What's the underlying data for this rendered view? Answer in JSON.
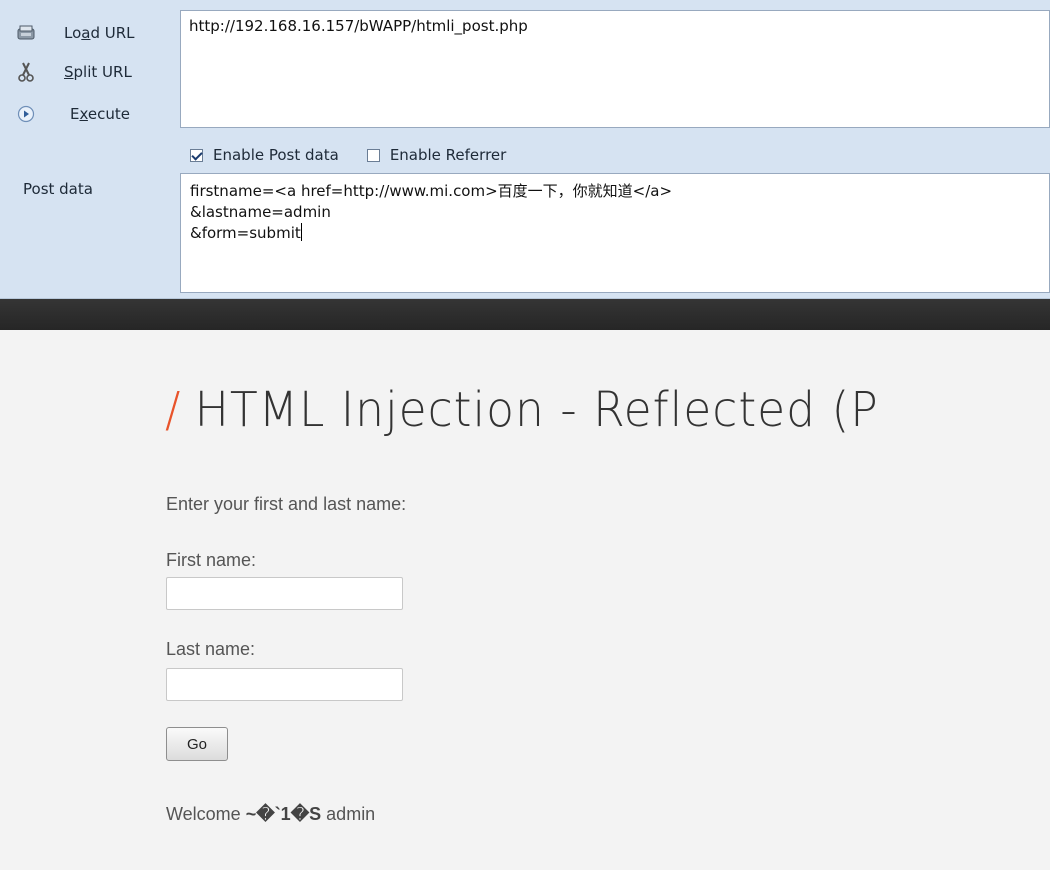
{
  "hackbar": {
    "buttons": [
      {
        "label_pre": "Lo",
        "label_key": "a",
        "label_post": "d URL",
        "icon": "load-url-icon"
      },
      {
        "label_pre": "",
        "label_key": "S",
        "label_post": "plit URL",
        "icon": "scissors-icon"
      },
      {
        "label_pre": "E",
        "label_key": "x",
        "label_post": "ecute",
        "icon": "execute-play-icon"
      }
    ],
    "url_value": "http://192.168.16.157/bWAPP/htmli_post.php",
    "enable_post_label": "Enable Post data",
    "enable_post_checked": true,
    "enable_referrer_label": "Enable Referrer",
    "enable_referrer_checked": false,
    "post_data_label": "Post data",
    "post_data_lines": [
      "firstname=<a href=http://www.mi.com>百度一下，你就知道</a>",
      "&lastname=admin",
      "&form=submit"
    ]
  },
  "page": {
    "title_slash": "/",
    "title": "HTML Injection - Reflected (P",
    "intro": "Enter your first and last name:",
    "first_name_label": "First name:",
    "last_name_label": "Last name:",
    "go_label": "Go",
    "welcome_prefix": "Welcome",
    "welcome_name": "~�`1�S",
    "welcome_suffix": "admin"
  },
  "colors": {
    "hackbar_bg": "#d6e3f2",
    "title_slash": "#e8532a",
    "header_strip": "#2a2a2a"
  }
}
